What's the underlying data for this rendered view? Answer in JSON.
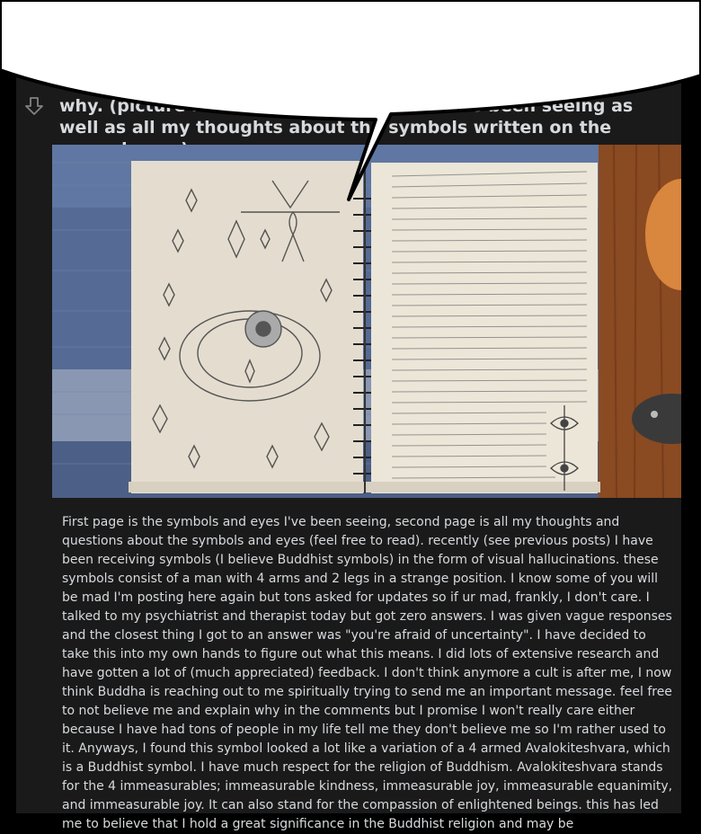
{
  "post": {
    "title": "why. (picture includes multiple symbols I've been seeing as well as all my thoughts about the symbols written on the second page)",
    "body": "First page is the symbols and eyes I've been seeing, second page is all my thoughts and questions about the symbols and eyes (feel free to read). recently (see previous posts) I have been receiving symbols (I believe Buddhist symbols) in the form of visual hallucinations. these symbols consist of a man with 4 arms and 2 legs in a strange position. I know some of you will be mad I'm posting here again but tons asked for updates so if ur mad, frankly, I don't care. I talked to my psychiatrist and therapist today but got zero answers. I was given vague responses and the closest thing I got to an answer was \"you're afraid of uncertainty\". I have decided to take this into my own hands to figure out what this means. I did lots of extensive research and have gotten a lot of (much appreciated) feedback. I don't think anymore a cult is after me, I now think Buddha is reaching out to me spiritually trying to send me an important message. feel free to not believe me and explain why in the comments but I promise I won't really care either because I have had tons of people in my life tell me they don't believe me so I'm rather used to it. Anyways, I found this symbol looked a lot like a variation of a 4 armed Avalokiteshvara, which is a Buddhist symbol. I have much respect for the religion of Buddhism. Avalokiteshvara stands for the 4 immeasurables; immeasurable kindness, immeasurable joy, immeasurable equanimity, and immeasurable joy. It can also stand for the compassion of enlightened beings. this has led me to believe that I hold a great significance in the Buddhist religion and may be"
  },
  "icons": {
    "downvote": "downvote-arrow-icon"
  },
  "colors": {
    "page_bg": "#000000",
    "card_bg": "#1a1a1b",
    "text": "#d7dadc",
    "icon": "#818384",
    "bubble": "#ffffff"
  }
}
